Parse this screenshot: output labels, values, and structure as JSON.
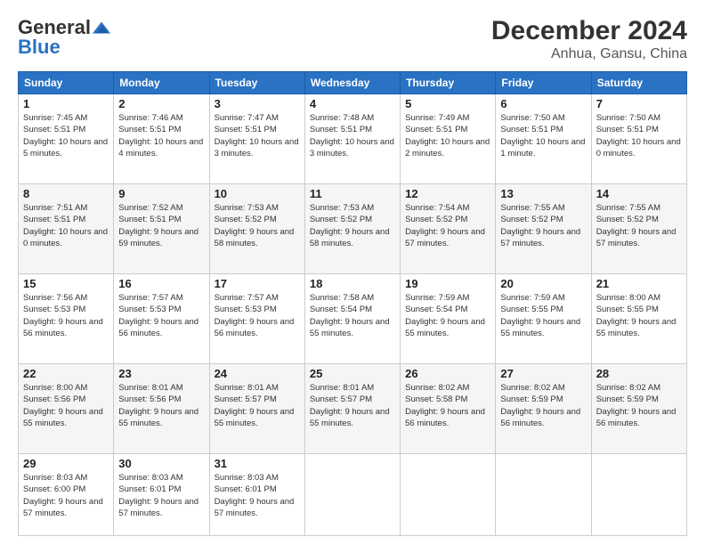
{
  "header": {
    "logo_general": "General",
    "logo_blue": "Blue",
    "title": "December 2024",
    "subtitle": "Anhua, Gansu, China"
  },
  "days_of_week": [
    "Sunday",
    "Monday",
    "Tuesday",
    "Wednesday",
    "Thursday",
    "Friday",
    "Saturday"
  ],
  "weeks": [
    [
      {
        "day": "1",
        "sunrise": "Sunrise: 7:45 AM",
        "sunset": "Sunset: 5:51 PM",
        "daylight": "Daylight: 10 hours and 5 minutes."
      },
      {
        "day": "2",
        "sunrise": "Sunrise: 7:46 AM",
        "sunset": "Sunset: 5:51 PM",
        "daylight": "Daylight: 10 hours and 4 minutes."
      },
      {
        "day": "3",
        "sunrise": "Sunrise: 7:47 AM",
        "sunset": "Sunset: 5:51 PM",
        "daylight": "Daylight: 10 hours and 3 minutes."
      },
      {
        "day": "4",
        "sunrise": "Sunrise: 7:48 AM",
        "sunset": "Sunset: 5:51 PM",
        "daylight": "Daylight: 10 hours and 3 minutes."
      },
      {
        "day": "5",
        "sunrise": "Sunrise: 7:49 AM",
        "sunset": "Sunset: 5:51 PM",
        "daylight": "Daylight: 10 hours and 2 minutes."
      },
      {
        "day": "6",
        "sunrise": "Sunrise: 7:50 AM",
        "sunset": "Sunset: 5:51 PM",
        "daylight": "Daylight: 10 hours and 1 minute."
      },
      {
        "day": "7",
        "sunrise": "Sunrise: 7:50 AM",
        "sunset": "Sunset: 5:51 PM",
        "daylight": "Daylight: 10 hours and 0 minutes."
      }
    ],
    [
      {
        "day": "8",
        "sunrise": "Sunrise: 7:51 AM",
        "sunset": "Sunset: 5:51 PM",
        "daylight": "Daylight: 10 hours and 0 minutes."
      },
      {
        "day": "9",
        "sunrise": "Sunrise: 7:52 AM",
        "sunset": "Sunset: 5:51 PM",
        "daylight": "Daylight: 9 hours and 59 minutes."
      },
      {
        "day": "10",
        "sunrise": "Sunrise: 7:53 AM",
        "sunset": "Sunset: 5:52 PM",
        "daylight": "Daylight: 9 hours and 58 minutes."
      },
      {
        "day": "11",
        "sunrise": "Sunrise: 7:53 AM",
        "sunset": "Sunset: 5:52 PM",
        "daylight": "Daylight: 9 hours and 58 minutes."
      },
      {
        "day": "12",
        "sunrise": "Sunrise: 7:54 AM",
        "sunset": "Sunset: 5:52 PM",
        "daylight": "Daylight: 9 hours and 57 minutes."
      },
      {
        "day": "13",
        "sunrise": "Sunrise: 7:55 AM",
        "sunset": "Sunset: 5:52 PM",
        "daylight": "Daylight: 9 hours and 57 minutes."
      },
      {
        "day": "14",
        "sunrise": "Sunrise: 7:55 AM",
        "sunset": "Sunset: 5:52 PM",
        "daylight": "Daylight: 9 hours and 57 minutes."
      }
    ],
    [
      {
        "day": "15",
        "sunrise": "Sunrise: 7:56 AM",
        "sunset": "Sunset: 5:53 PM",
        "daylight": "Daylight: 9 hours and 56 minutes."
      },
      {
        "day": "16",
        "sunrise": "Sunrise: 7:57 AM",
        "sunset": "Sunset: 5:53 PM",
        "daylight": "Daylight: 9 hours and 56 minutes."
      },
      {
        "day": "17",
        "sunrise": "Sunrise: 7:57 AM",
        "sunset": "Sunset: 5:53 PM",
        "daylight": "Daylight: 9 hours and 56 minutes."
      },
      {
        "day": "18",
        "sunrise": "Sunrise: 7:58 AM",
        "sunset": "Sunset: 5:54 PM",
        "daylight": "Daylight: 9 hours and 55 minutes."
      },
      {
        "day": "19",
        "sunrise": "Sunrise: 7:59 AM",
        "sunset": "Sunset: 5:54 PM",
        "daylight": "Daylight: 9 hours and 55 minutes."
      },
      {
        "day": "20",
        "sunrise": "Sunrise: 7:59 AM",
        "sunset": "Sunset: 5:55 PM",
        "daylight": "Daylight: 9 hours and 55 minutes."
      },
      {
        "day": "21",
        "sunrise": "Sunrise: 8:00 AM",
        "sunset": "Sunset: 5:55 PM",
        "daylight": "Daylight: 9 hours and 55 minutes."
      }
    ],
    [
      {
        "day": "22",
        "sunrise": "Sunrise: 8:00 AM",
        "sunset": "Sunset: 5:56 PM",
        "daylight": "Daylight: 9 hours and 55 minutes."
      },
      {
        "day": "23",
        "sunrise": "Sunrise: 8:01 AM",
        "sunset": "Sunset: 5:56 PM",
        "daylight": "Daylight: 9 hours and 55 minutes."
      },
      {
        "day": "24",
        "sunrise": "Sunrise: 8:01 AM",
        "sunset": "Sunset: 5:57 PM",
        "daylight": "Daylight: 9 hours and 55 minutes."
      },
      {
        "day": "25",
        "sunrise": "Sunrise: 8:01 AM",
        "sunset": "Sunset: 5:57 PM",
        "daylight": "Daylight: 9 hours and 55 minutes."
      },
      {
        "day": "26",
        "sunrise": "Sunrise: 8:02 AM",
        "sunset": "Sunset: 5:58 PM",
        "daylight": "Daylight: 9 hours and 56 minutes."
      },
      {
        "day": "27",
        "sunrise": "Sunrise: 8:02 AM",
        "sunset": "Sunset: 5:59 PM",
        "daylight": "Daylight: 9 hours and 56 minutes."
      },
      {
        "day": "28",
        "sunrise": "Sunrise: 8:02 AM",
        "sunset": "Sunset: 5:59 PM",
        "daylight": "Daylight: 9 hours and 56 minutes."
      }
    ],
    [
      {
        "day": "29",
        "sunrise": "Sunrise: 8:03 AM",
        "sunset": "Sunset: 6:00 PM",
        "daylight": "Daylight: 9 hours and 57 minutes."
      },
      {
        "day": "30",
        "sunrise": "Sunrise: 8:03 AM",
        "sunset": "Sunset: 6:01 PM",
        "daylight": "Daylight: 9 hours and 57 minutes."
      },
      {
        "day": "31",
        "sunrise": "Sunrise: 8:03 AM",
        "sunset": "Sunset: 6:01 PM",
        "daylight": "Daylight: 9 hours and 57 minutes."
      },
      null,
      null,
      null,
      null
    ]
  ]
}
